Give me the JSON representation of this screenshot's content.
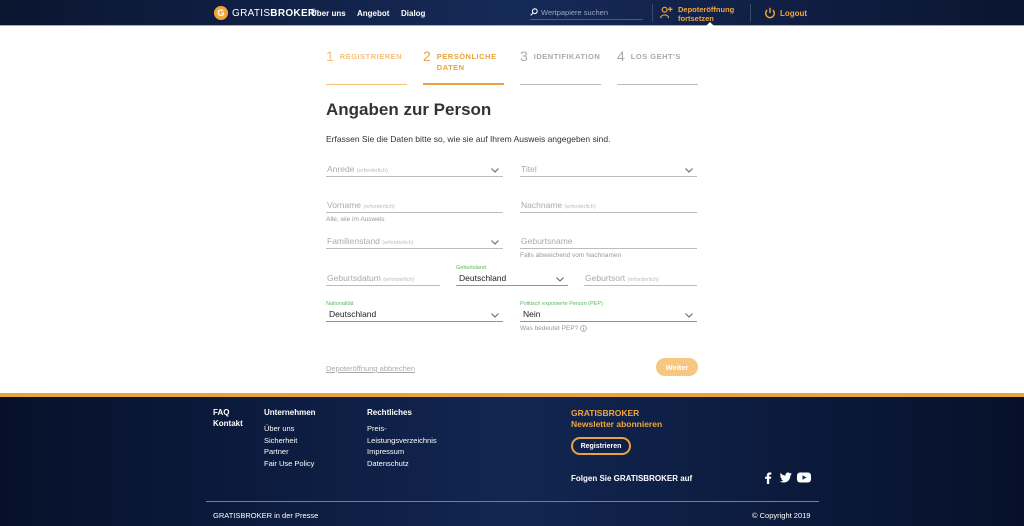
{
  "header": {
    "logo_letter": "G",
    "logo_text_light": "GRATIS",
    "logo_text_bold": "BROKER",
    "nav": [
      "Über uns",
      "Angebot",
      "Dialog"
    ],
    "search_placeholder": "Wertpapiere suchen",
    "continue_line1": "Depoteröffnung",
    "continue_line2": "fortsetzen",
    "logout": "Logout"
  },
  "steps": [
    {
      "num": "1",
      "label": "REGISTRIEREN",
      "state": "done"
    },
    {
      "num": "2",
      "label_line1": "PERSÖNLICHE",
      "label_line2": "DATEN",
      "state": "active"
    },
    {
      "num": "3",
      "label": "IDENTIFIKATION",
      "state": "todo"
    },
    {
      "num": "4",
      "label": "LOS GEHT'S",
      "state": "todo"
    }
  ],
  "form": {
    "title": "Angaben zur Person",
    "intro": "Erfassen Sie die Daten bitte so, wie sie auf Ihrem Ausweis angegeben sind.",
    "required_suffix": "(erforderlich)",
    "anrede": "Anrede",
    "titel": "Titel",
    "vorname": "Vorname",
    "vorname_hint": "Alle, wie im Ausweis",
    "nachname": "Nachname",
    "familienstand": "Familienstand",
    "geburtsname": "Geburtsname",
    "geburtsname_hint": "Falls abweichend vom Nachnamen",
    "geburtsdatum": "Geburtsdatum",
    "geburtsland_label": "Geburtsland",
    "geburtsland_value": "Deutschland",
    "geburtsort": "Geburtsort",
    "nationalitaet_label": "Nationalität",
    "nationalitaet_value": "Deutschland",
    "pep_label": "Politisch exponierte Person (PEP)",
    "pep_value": "Nein",
    "pep_hint": "Was bedeutet PEP?",
    "cancel": "Depoteröffnung abbrechen",
    "next": "Weiter"
  },
  "footer": {
    "faq": "FAQ",
    "kontakt": "Kontakt",
    "unternehmen_heading": "Unternehmen",
    "unternehmen_items": [
      "Über uns",
      "Sicherheit",
      "Partner",
      "Fair Use Policy"
    ],
    "rechtliches_heading": "Rechtliches",
    "rechtliches_items": [
      "Preis-",
      "Leistungsverzeichnis",
      "Impressum",
      "Datenschutz"
    ],
    "newsletter_line1": "GRATISBROKER",
    "newsletter_line2": "Newsletter abonnieren",
    "register_button": "Registrieren",
    "follow": "Folgen Sie GRATISBROKER auf",
    "press": "GRATISBROKER in der Presse",
    "copyright": "© Copyright 2019"
  },
  "colors": {
    "accent": "#e8a33c",
    "header_bg": "#0f1f45",
    "valid_green": "#5cb85c"
  }
}
